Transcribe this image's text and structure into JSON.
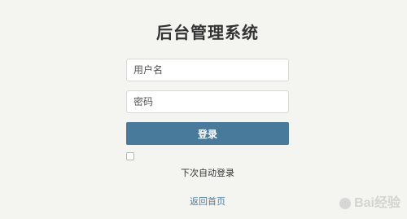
{
  "page": {
    "title": "后台管理系统"
  },
  "form": {
    "username_placeholder": "用户名",
    "password_placeholder": "密码",
    "login_label": "登录",
    "remember_label": "下次自动登录",
    "remember_checked": false,
    "home_link": "返回首页"
  },
  "watermark": {
    "text": "Bai经验"
  },
  "colors": {
    "background": "#f4f4f1",
    "button": "#487a9b",
    "link": "#4a7fa6"
  }
}
